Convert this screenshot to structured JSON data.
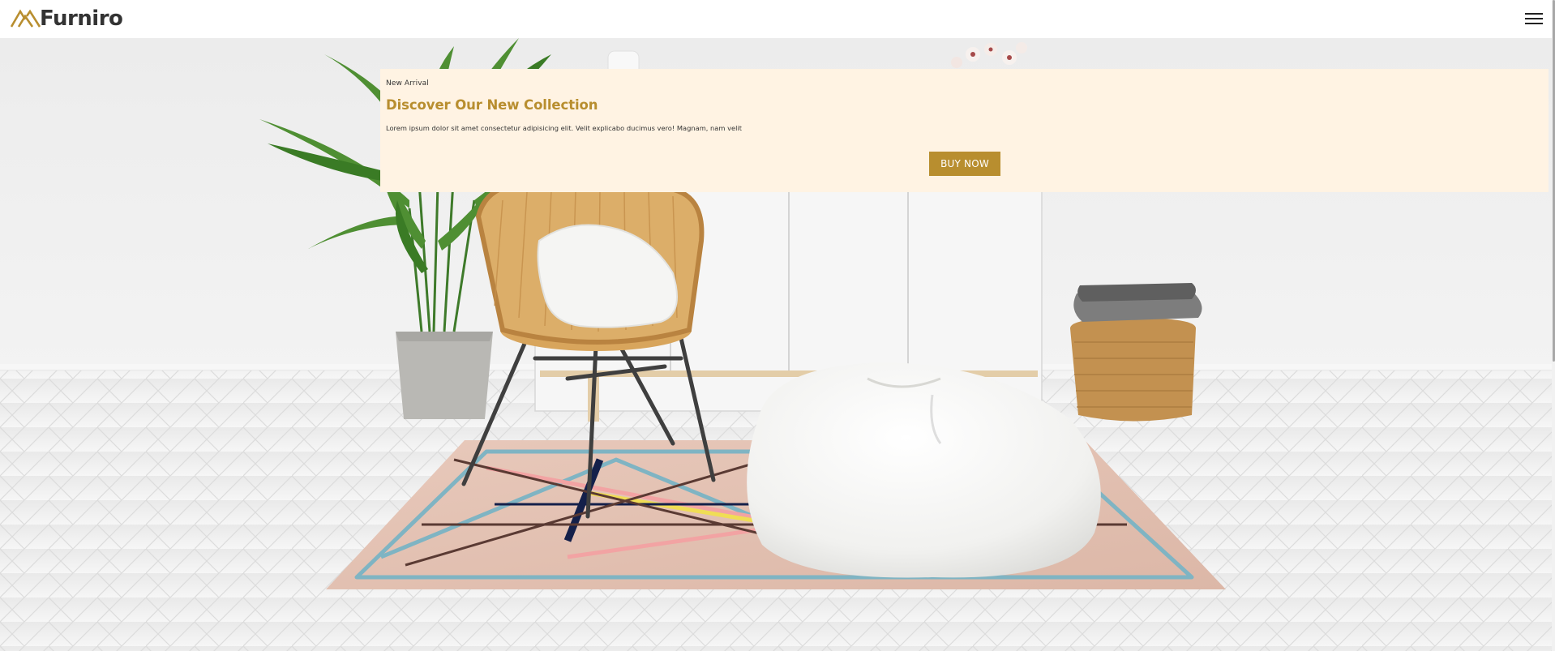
{
  "header": {
    "brand": "Furniro",
    "logo_icon": "furniro-logo-icon",
    "menu_icon": "hamburger-menu-icon"
  },
  "promo": {
    "eyebrow": "New Arrival",
    "title": "Discover Our New Collection",
    "description": "Lorem ipsum dolor sit amet consectetur adipisicing elit. Velit explicabo ducimus vero! Magnam, nam velit",
    "cta_label": "BUY NOW"
  },
  "hero_image": {
    "subject": "living room with rattan chair, white bean bag, plant, rug and basket"
  },
  "colors": {
    "brand_gold": "#b88e2f",
    "promo_background": "#fff3e3",
    "logo_text": "#333333"
  }
}
